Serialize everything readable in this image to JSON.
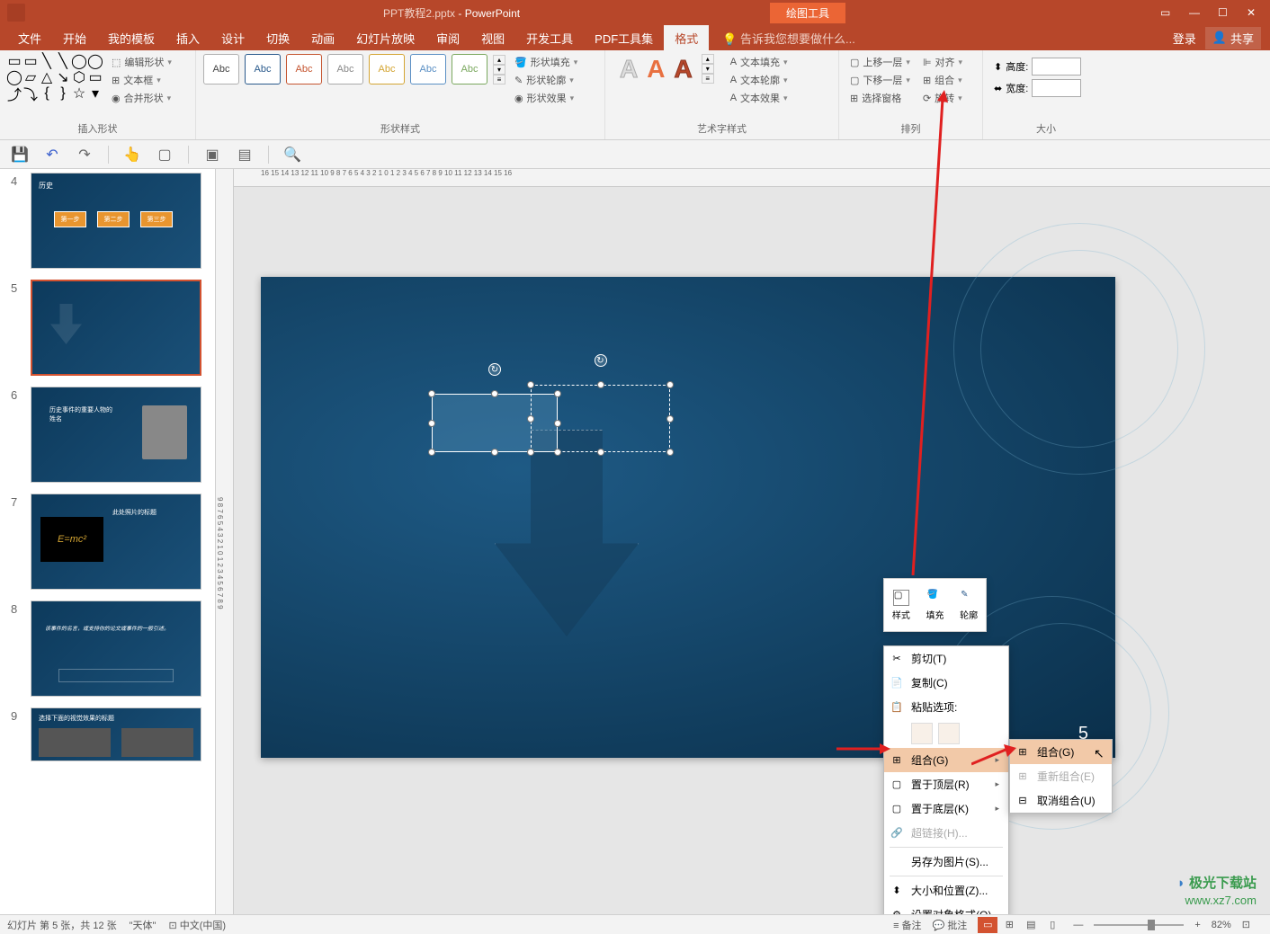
{
  "titlebar": {
    "filename": "PPT教程2.pptx",
    "app": "PowerPoint",
    "drawing_tools": "绘图工具"
  },
  "window_controls": {
    "tooltip_min": "最小化",
    "tooltip_max": "最大化",
    "tooltip_close": "关闭"
  },
  "menu": {
    "items": [
      "文件",
      "开始",
      "我的模板",
      "插入",
      "设计",
      "切换",
      "动画",
      "幻灯片放映",
      "审阅",
      "视图",
      "开发工具",
      "PDF工具集",
      "格式"
    ],
    "active_index": 12,
    "tell_me": "告诉我您想要做什么...",
    "login": "登录",
    "share": "共享"
  },
  "ribbon": {
    "insert_shape": {
      "label": "插入形状",
      "edit_shape": "编辑形状",
      "text_box": "文本框",
      "merge_shape": "合并形状"
    },
    "shape_style": {
      "label": "形状样式",
      "sample_text": "Abc",
      "fill": "形状填充",
      "outline": "形状轮廓",
      "effects": "形状效果"
    },
    "wordart": {
      "label": "艺术字样式",
      "text_fill": "文本填充",
      "text_outline": "文本轮廓",
      "text_effects": "文本效果"
    },
    "arrange": {
      "label": "排列",
      "bring_fwd": "上移一层",
      "send_back": "下移一层",
      "selection_pane": "选择窗格",
      "align": "对齐",
      "group": "组合",
      "rotate": "旋转"
    },
    "size": {
      "label": "大小",
      "height": "高度:",
      "width": "宽度:",
      "height_val": "",
      "width_val": ""
    }
  },
  "ruler_h": "16 15 14 13 12 11 10 9 8 7 6 5 4 3 2 1 0 1 2 3 4 5 6 7 8 9 10 11 12 13 14 15 16",
  "ruler_v": "9 8 7 6 5 4 3 2 1 0 1 2 3 4 5 6 7 8 9",
  "thumbs": [
    {
      "num": "4",
      "labels": [
        "第一步",
        "第二步",
        "第三步"
      ],
      "title": "历史"
    },
    {
      "num": "5"
    },
    {
      "num": "6",
      "title": "历史事件的重要人物的姓名"
    },
    {
      "num": "7",
      "title": "此处照片的标题",
      "eq": "E=mc²"
    },
    {
      "num": "8",
      "text": "该事件的名言，或支持你的论文或事件的一般引述。"
    },
    {
      "num": "9",
      "title": "选择下面的视觉效果的标题"
    }
  ],
  "slide": {
    "number": "5"
  },
  "mini_toolbar": {
    "style": "样式",
    "fill": "填充",
    "outline": "轮廓"
  },
  "context_menu": {
    "cut": "剪切(T)",
    "copy": "复制(C)",
    "paste_options": "粘贴选项:",
    "group": "组合(G)",
    "bring_to_front": "置于顶层(R)",
    "send_to_back": "置于底层(K)",
    "hyperlink": "超链接(H)...",
    "save_as_picture": "另存为图片(S)...",
    "size_position": "大小和位置(Z)...",
    "format_object": "设置对象格式(O)..."
  },
  "submenu": {
    "group": "组合(G)",
    "regroup": "重新组合(E)",
    "ungroup": "取消组合(U)"
  },
  "status": {
    "slide_info": "幻灯片 第 5 张，共 12 张",
    "theme": "\"天体\"",
    "lang": "中文(中国)",
    "notes": "备注",
    "comments": "批注",
    "zoom": "82%"
  },
  "watermark": {
    "logo_text": "极光下载站",
    "url": "www.xz7.com"
  }
}
